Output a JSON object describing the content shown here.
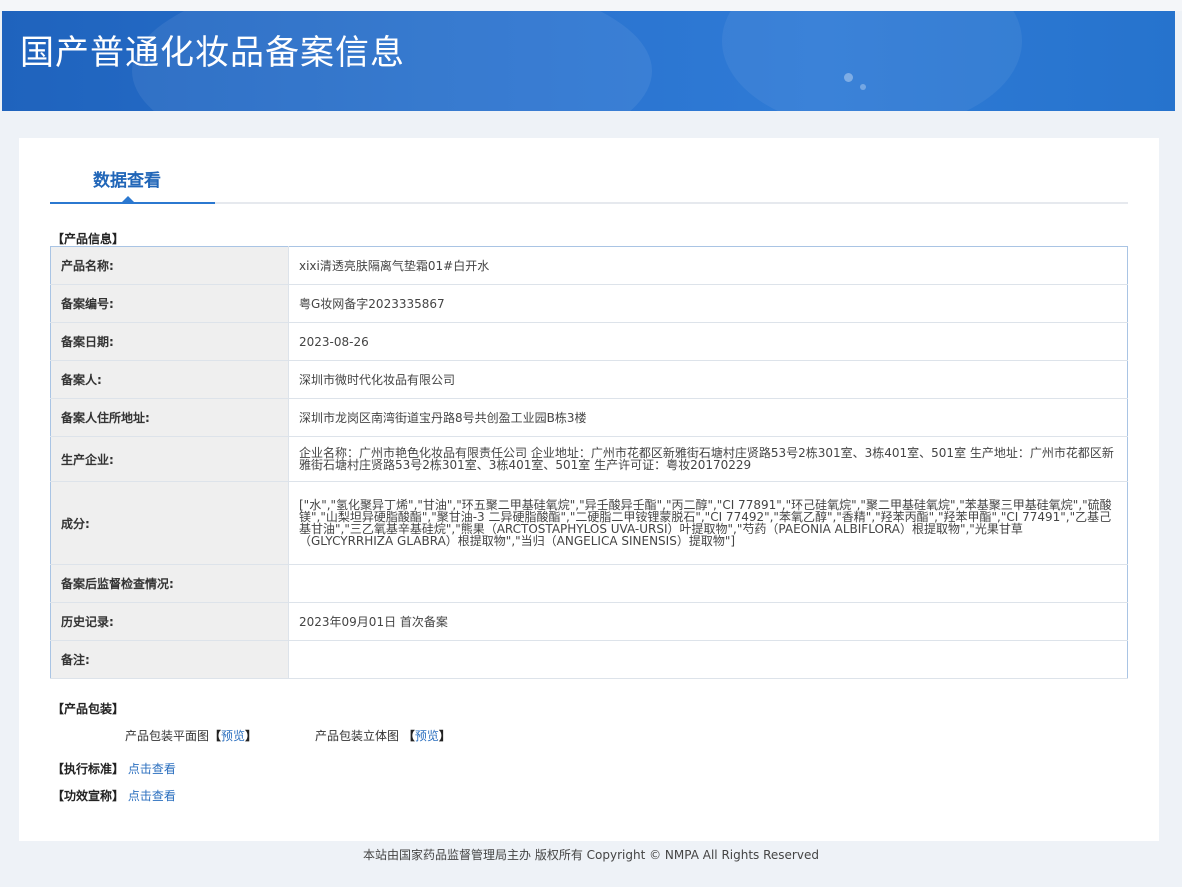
{
  "banner": {
    "title": "国产普通化妆品备案信息"
  },
  "tabs": {
    "active": "数据查看"
  },
  "product_info": {
    "section_title": "【产品信息】",
    "rows": [
      {
        "label": "产品名称:",
        "value": "xixi清透亮肤隔离气垫霜01#白开水"
      },
      {
        "label": "备案编号:",
        "value": "粤G妆网备字2023335867"
      },
      {
        "label": "备案日期:",
        "value": "2023-08-26"
      },
      {
        "label": "备案人:",
        "value": "深圳市微时代化妆品有限公司"
      },
      {
        "label": "备案人住所地址:",
        "value": "深圳市龙岗区南湾街道宝丹路8号共创盈工业园B栋3楼"
      },
      {
        "label": "生产企业:",
        "value": "企业名称：广州市艳色化妆品有限责任公司 企业地址：广州市花都区新雅街石塘村庄贤路53号2栋301室、3栋401室、501室 生产地址：广州市花都区新雅街石塘村庄贤路53号2栋301室、3栋401室、501室 生产许可证：粤妆20170229"
      },
      {
        "label": "成分:",
        "value": "[\"水\",\"氢化聚异丁烯\",\"甘油\",\"环五聚二甲基硅氧烷\",\"异壬酸异壬酯\",\"丙二醇\",\"CI 77891\",\"环己硅氧烷\",\"聚二甲基硅氧烷\",\"苯基聚三甲基硅氧烷\",\"硫酸镁\",\"山梨坦异硬脂酸酯\",\"聚甘油-3 二异硬脂酸酯\",\"二硬脂二甲铵锂蒙脱石\",\"CI 77492\",\"苯氧乙醇\",\"香精\",\"羟苯丙酯\",\"羟苯甲酯\",\"CI 77491\",\"乙基己基甘油\",\"三乙氧基辛基硅烷\",\"熊果（ARCTOSTAPHYLOS UVA-URSI）叶提取物\",\"芍药（PAEONIA ALBIFLORA）根提取物\",\"光果甘草（GLYCYRRHIZA GLABRA）根提取物\",\"当归（ANGELICA SINENSIS）提取物\"]"
      },
      {
        "label": "备案后监督检查情况:",
        "value": ""
      },
      {
        "label": "历史记录:",
        "value": "2023年09月01日 首次备案"
      },
      {
        "label": "备注:",
        "value": ""
      }
    ]
  },
  "packaging": {
    "section_title": "【产品包装】",
    "flat_label": "产品包装平面图",
    "solid_label": "产品包装立体图",
    "preview_link": "预览",
    "bracket_open": "【",
    "bracket_close": "】"
  },
  "standard": {
    "label": "【执行标准】",
    "link": "点击查看"
  },
  "efficacy": {
    "label": "【功效宣称】",
    "link": "点击查看"
  },
  "footer": {
    "text": "本站由国家药品监督管理局主办 版权所有 Copyright © NMPA All Rights Reserved"
  }
}
